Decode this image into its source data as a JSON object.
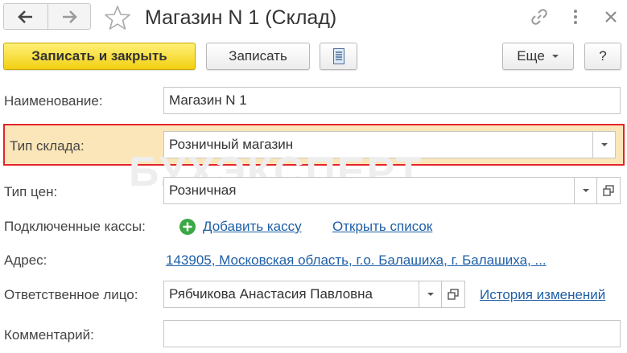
{
  "window": {
    "title": "Магазин N 1 (Склад)"
  },
  "icons": {
    "back": "arrow-left",
    "forward": "arrow-right",
    "favorite": "star-outline",
    "link": "link-chain",
    "more": "vertical-dots",
    "close": "x"
  },
  "toolbar": {
    "save_close": "Записать и закрыть",
    "save": "Записать",
    "more": "Еще",
    "help": "?"
  },
  "watermark": "БУХЭКСПЕРТ",
  "form": {
    "name": {
      "label": "Наименование:",
      "value": "Магазин N 1"
    },
    "warehouse_type": {
      "label": "Тип склада:",
      "value": "Розничный магазин"
    },
    "price_type": {
      "label": "Тип цен:",
      "value": "Розничная"
    },
    "registers": {
      "label": "Подключенные кассы:",
      "add": "Добавить кассу",
      "open_list": "Открыть список"
    },
    "address": {
      "label": "Адрес:",
      "value": "143905, Московская область, г.о. Балашиха, г. Балашиха, ..."
    },
    "responsible": {
      "label": "Ответственное лицо:",
      "value": "Рябчикова Анастасия Павловна",
      "history": "История изменений"
    },
    "comment": {
      "label": "Комментарий:",
      "value": ""
    }
  },
  "colors": {
    "primary_button": "#f2cf13",
    "highlight_bg": "#fbe6b9",
    "highlight_border": "#e2262b",
    "link": "#1f5fa6",
    "add_icon": "#3aa845"
  }
}
